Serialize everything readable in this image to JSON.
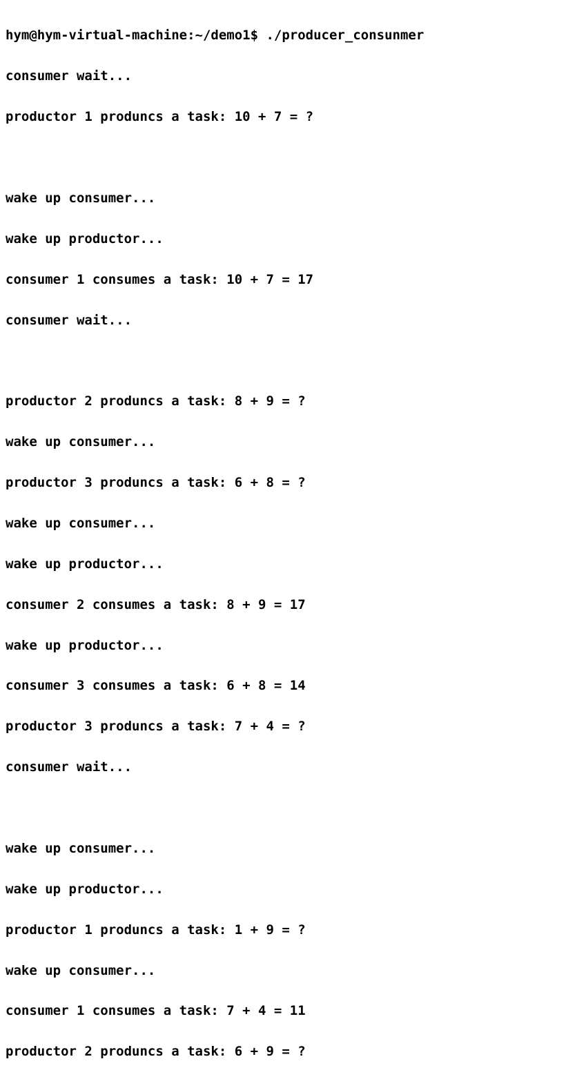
{
  "prompt": {
    "user": "hym",
    "host": "hym-virtual-machine",
    "cwd": "~/demo1",
    "symbol": "$",
    "command": "./producer_consunmer"
  },
  "lines": [
    "hym@hym-virtual-machine:~/demo1$ ./producer_consunmer",
    "consumer wait...",
    "productor 1 produncs a task: 10 + 7 = ?",
    "",
    "wake up consumer...",
    "wake up productor...",
    "consumer 1 consumes a task: 10 + 7 = 17",
    "consumer wait...",
    "",
    "productor 2 produncs a task: 8 + 9 = ?",
    "wake up consumer...",
    "productor 3 produncs a task: 6 + 8 = ?",
    "wake up consumer...",
    "wake up productor...",
    "consumer 2 consumes a task: 8 + 9 = 17",
    "wake up productor...",
    "consumer 3 consumes a task: 6 + 8 = 14",
    "productor 3 produncs a task: 7 + 4 = ?",
    "consumer wait...",
    "",
    "wake up consumer...",
    "wake up productor...",
    "productor 1 produncs a task: 1 + 9 = ?",
    "wake up consumer...",
    "consumer 1 consumes a task: 7 + 4 = 11",
    "productor 2 produncs a task: 6 + 9 = ?"
  ]
}
